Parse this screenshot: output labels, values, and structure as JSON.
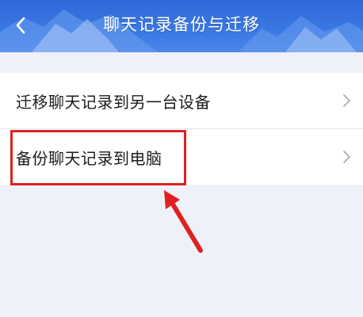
{
  "header": {
    "title": "聊天记录备份与迁移",
    "back_icon": "chevron-left-icon",
    "background_color": "#3a78e3"
  },
  "list": {
    "items": [
      {
        "label": "迁移聊天记录到另一台设备",
        "icon": "chevron-right-icon"
      },
      {
        "label": "备份聊天记录到电脑",
        "icon": "chevron-right-icon"
      }
    ]
  },
  "annotation": {
    "highlight_color": "#e02020",
    "arrow_color": "#e02020"
  }
}
